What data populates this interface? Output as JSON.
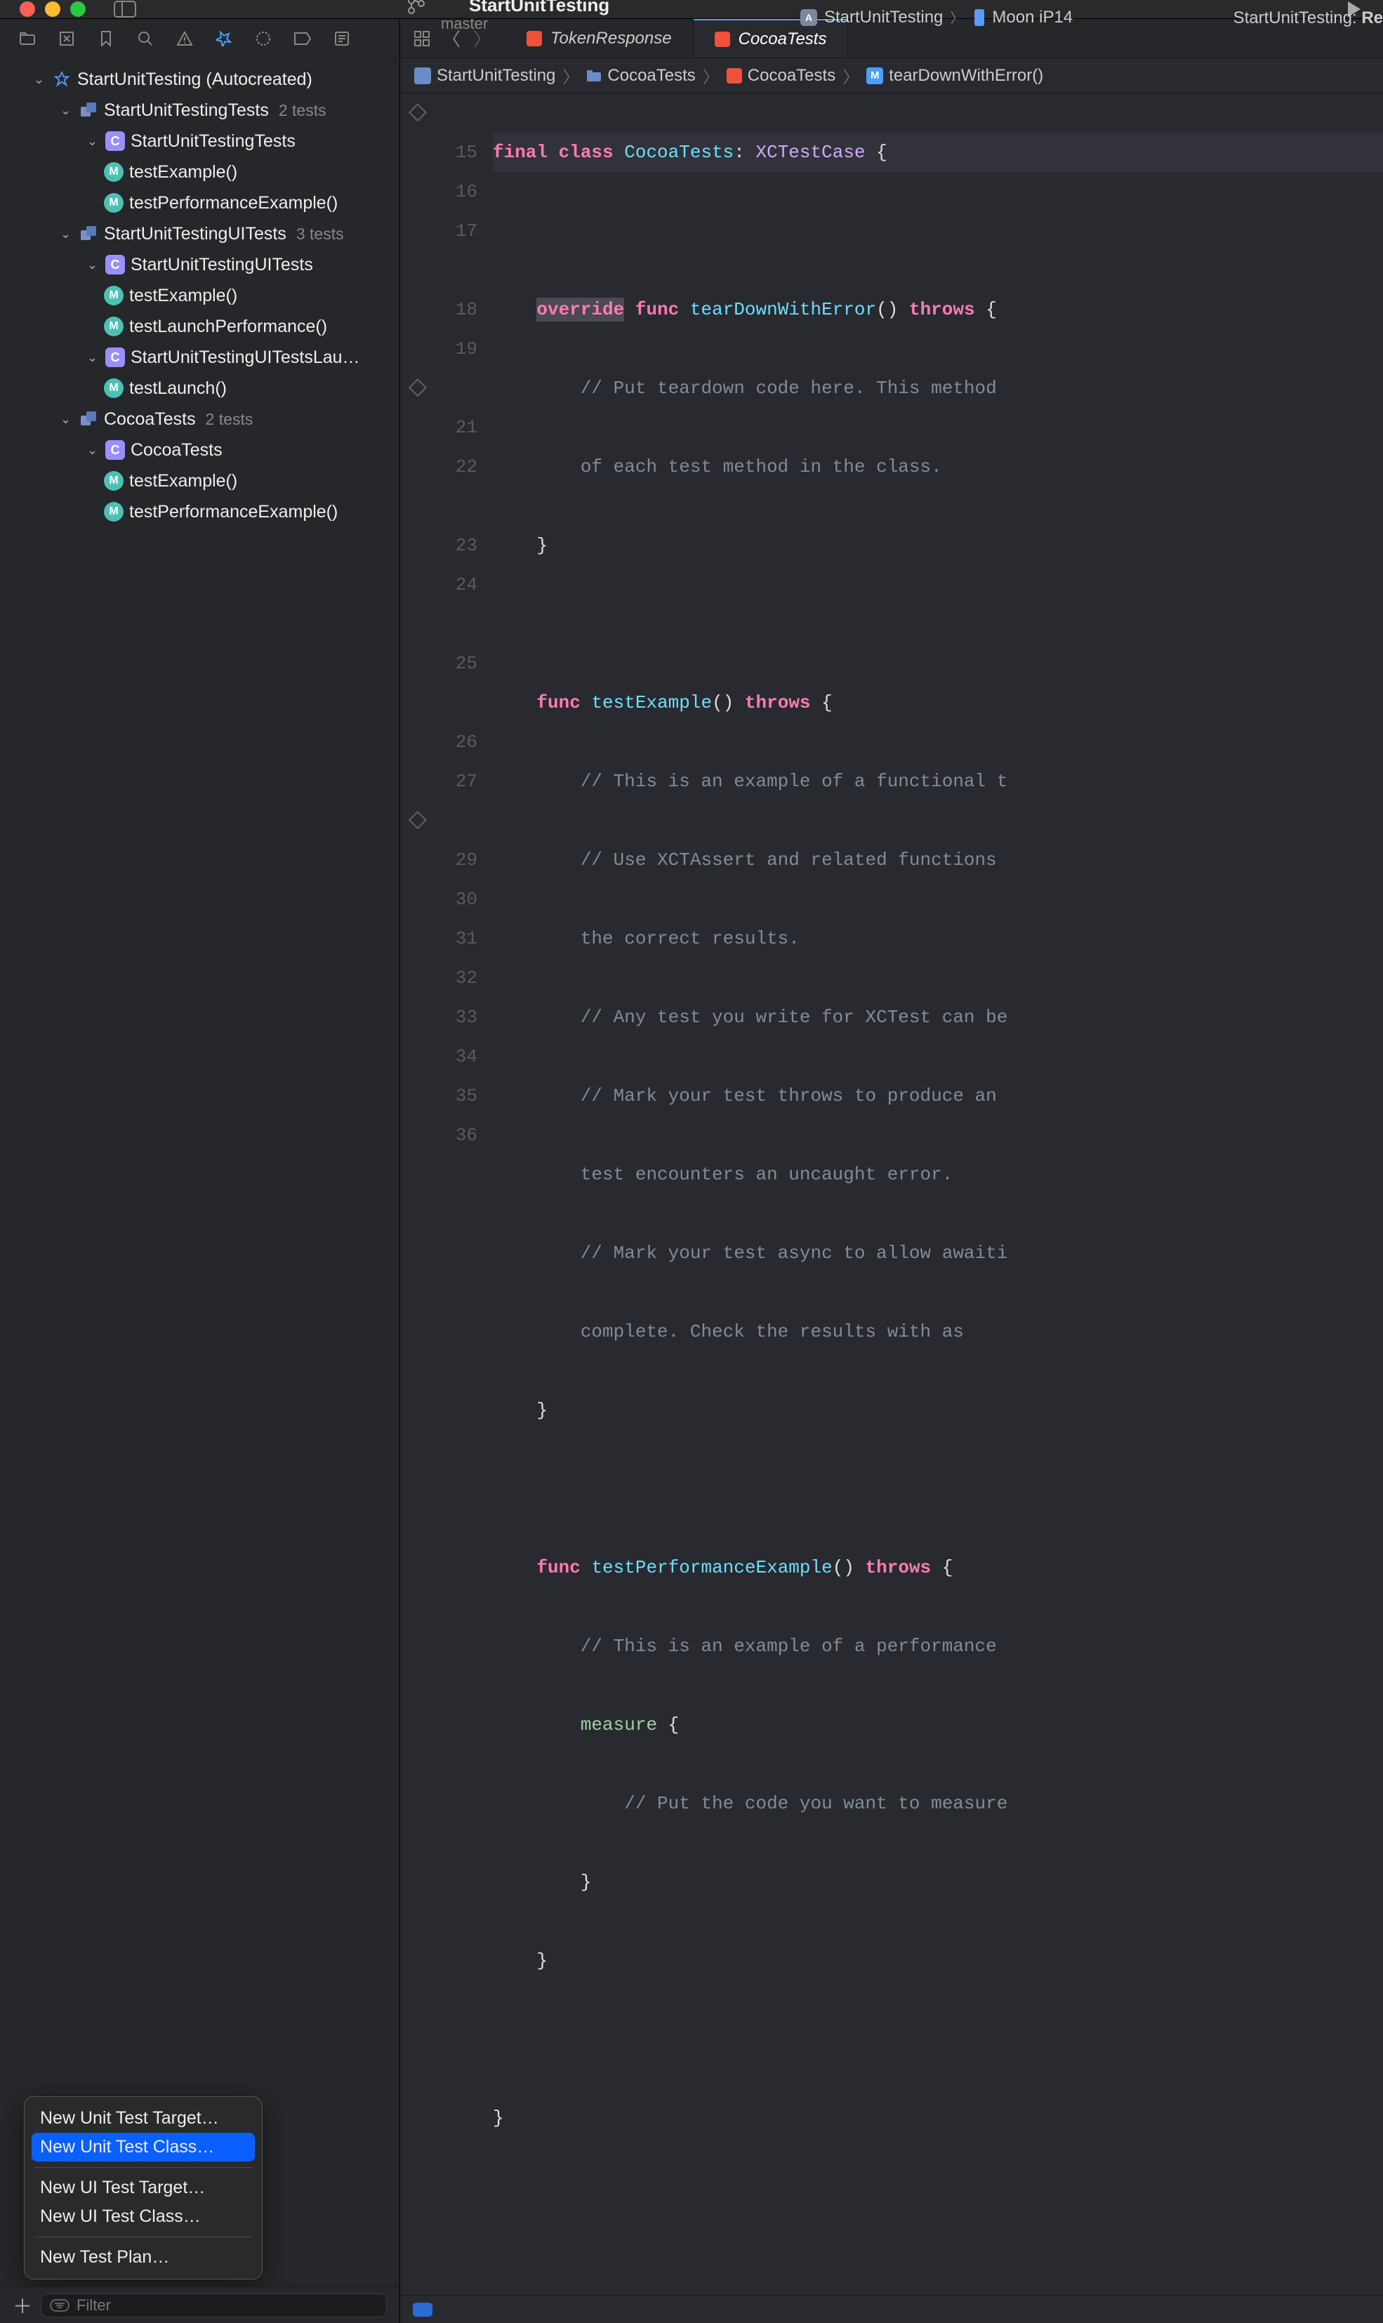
{
  "titlebar": {
    "project": "StartUnitTesting",
    "branch": "master",
    "scheme": "StartUnitTesting",
    "device": "Moon iP14",
    "status_prefix": "StartUnitTesting: ",
    "status_word": "Re"
  },
  "navTabs": {
    "tab1": "TokenResponse",
    "tab2": "CocoaTests"
  },
  "jumpbar": {
    "p1": "StartUnitTesting",
    "p2": "CocoaTests",
    "p3": "CocoaTests",
    "p4": "tearDownWithError()"
  },
  "tree": {
    "root": "StartUnitTesting (Autocreated)",
    "t1": "StartUnitTestingTests",
    "t1_count": "2 tests",
    "t1_c1": "StartUnitTestingTests",
    "t1_m1": "testExample()",
    "t1_m2": "testPerformanceExample()",
    "t2": "StartUnitTestingUITests",
    "t2_count": "3 tests",
    "t2_c1": "StartUnitTestingUITests",
    "t2_m1": "testExample()",
    "t2_m2": "testLaunchPerformance()",
    "t2_c2": "StartUnitTestingUITestsLau…",
    "t2_m3": "testLaunch()",
    "t3": "CocoaTests",
    "t3_count": "2 tests",
    "t3_c1": "CocoaTests",
    "t3_m1": "testExample()",
    "t3_m2": "testPerformanceExample()"
  },
  "ctxMenu": {
    "i1": "New Unit Test Target…",
    "i2": "New Unit Test Class…",
    "i3": "New UI Test Target…",
    "i4": "New UI Test Class…",
    "i5": "New Test Plan…"
  },
  "filter": {
    "placeholder": "Filter"
  },
  "code": {
    "lineNumbers": [
      "",
      "15",
      "16",
      "17",
      "",
      "18",
      "19",
      "",
      "21",
      "22",
      "",
      "23",
      "24",
      "",
      "25",
      "",
      "26",
      "27",
      "",
      "29",
      "30",
      "31",
      "32",
      "33",
      "34",
      "35",
      "36"
    ],
    "l_class": {
      "final": "final",
      "class": "class",
      "name": "CocoaTests",
      "colon": ":",
      "sup": "XCTestCase",
      "brace": "{"
    },
    "l16": {
      "override": "override",
      "func": "func",
      "name": "tearDownWithError",
      "parens": "()",
      "throws": "throws",
      "brace": "{"
    },
    "l17a": "// Put teardown code here. This method ",
    "l17b": "of each test method in the class.",
    "l18": "}",
    "l20": {
      "func": "func",
      "name": "testExample",
      "parens": "()",
      "throws": "throws",
      "brace": "{"
    },
    "l21": "// This is an example of a functional t",
    "l22a": "// Use XCTAssert and related functions ",
    "l22b": "the correct results.",
    "l23": "// Any test you write for XCTest can be",
    "l24a": "// Mark your test throws to produce an ",
    "l24b": "test encounters an uncaught error.",
    "l25a": "// Mark your test async to allow awaiti",
    "l25b": "complete. Check the results with as",
    "l26": "}",
    "l28": {
      "func": "func",
      "name": "testPerformanceExample",
      "parens": "()",
      "throws": "throws",
      "brace": "{"
    },
    "l29": "// This is an example of a performance ",
    "l30": {
      "measure": "measure",
      "brace": "{"
    },
    "l31": "// Put the code you want to measure",
    "l32": "}",
    "l33": "}",
    "l35": "}"
  }
}
